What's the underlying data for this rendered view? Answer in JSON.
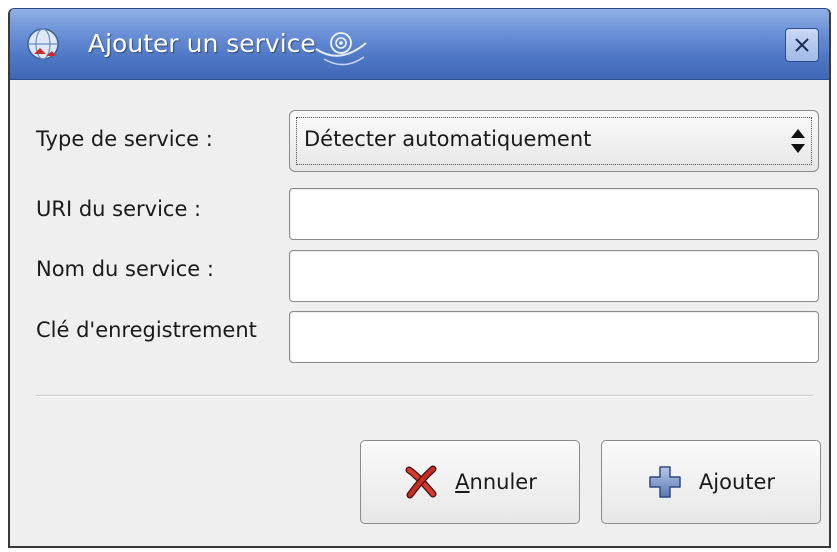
{
  "window": {
    "title": "Ajouter un service",
    "close_icon": "close-icon",
    "app_icon": "globe-icon"
  },
  "form": {
    "service_type_label": "Type de service :",
    "service_type_value": "Détecter automatiquement",
    "uri_label": "URI du service :",
    "uri_value": "",
    "name_label": "Nom du service :",
    "name_value": "",
    "key_label": "Clé d'enregistrement",
    "key_value": ""
  },
  "buttons": {
    "cancel_mnemonic": "A",
    "cancel_rest": "nnuler",
    "cancel_icon": "cancel-x-icon",
    "add_label": "Ajouter",
    "add_icon": "add-plus-icon"
  },
  "colors": {
    "titlebar": "#4d76c4",
    "background": "#efefef"
  }
}
